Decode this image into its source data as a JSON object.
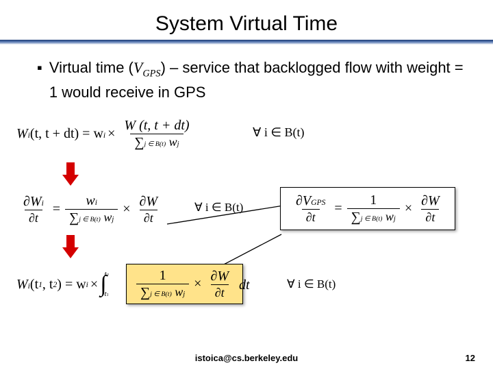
{
  "title": "System Virtual Time",
  "bullet": {
    "mark": "▪",
    "pre": "Virtual time (",
    "var": "V",
    "sub": "GPS",
    "post": ") – service that backlogged flow with weight = 1 would receive in GPS"
  },
  "eq1": {
    "lhs": "W",
    "lhs_sub": "i",
    "lhs_args": "(t, t + dt) = w",
    "lhs_args_sub": "i",
    "times": " × ",
    "frac_num": "W (t, t + dt)",
    "sum": "∑",
    "sum_sub": "j ∈ B(t)",
    "den_tail": " w",
    "den_tail_sub": "j",
    "cond": "∀ i ∈ B(t)"
  },
  "eq2": {
    "d": "∂",
    "W": "W",
    "i_sub": "i",
    "t": "t",
    "eq": " = ",
    "num_w": "w",
    "num_wi": "i",
    "sum": "∑",
    "sum_sub": "j ∈ B(t)",
    "den_tail": " w",
    "den_tail_sub": "j",
    "times": " × ",
    "rhs_W": "W",
    "cond": "∀ i ∈ B(t)"
  },
  "eqV": {
    "d": "∂",
    "V": "V",
    "V_sub": "GPS",
    "t": "t",
    "eq": " = ",
    "one": "1",
    "sum": "∑",
    "sum_sub": "j ∈ B(t)",
    "den_tail": " w",
    "den_tail_sub": "j",
    "times": " × ",
    "W": "W"
  },
  "eq3": {
    "W": "W",
    "i_sub": "i",
    "args": "(t",
    "t1sub": "1",
    "comma": ", t",
    "t2sub": "2",
    "close": ") = w",
    "wi_sub": "i",
    "times": " × ",
    "int": "∫",
    "int_lo": "t",
    "int_lo_sub": "1",
    "int_hi": "t",
    "int_hi_sub": "2",
    "one": "1",
    "sum": "∑",
    "sum_sub": "j ∈ B(t)",
    "den_tail": " w",
    "den_tail_sub": "j",
    "d": "∂",
    "Wr": "W",
    "tr": "t",
    "dt": " dt",
    "cond": "∀ i ∈ B(t)"
  },
  "footer": "istoica@cs.berkeley.edu",
  "page": "12"
}
